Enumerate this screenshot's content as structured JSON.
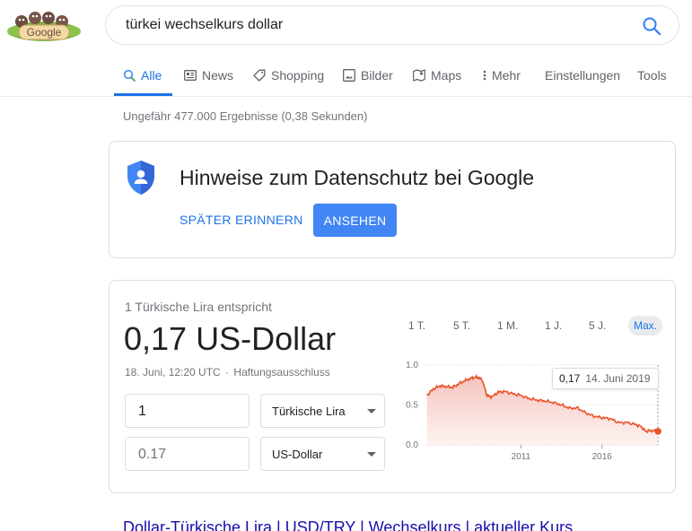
{
  "search": {
    "query": "türkei wechselkurs dollar"
  },
  "tabs": [
    {
      "label": "Alle"
    },
    {
      "label": "News"
    },
    {
      "label": "Shopping"
    },
    {
      "label": "Bilder"
    },
    {
      "label": "Maps"
    },
    {
      "label": "Mehr"
    },
    {
      "label": "Einstellungen"
    },
    {
      "label": "Tools"
    }
  ],
  "result_stats": "Ungefähr 477.000 Ergebnisse (0,38 Sekunden)",
  "privacy": {
    "title": "Hinweise zum Datenschutz bei Google",
    "later_label": "SPÄTER ERINNERN",
    "view_label": "ANSEHEN"
  },
  "currency": {
    "equivalent_label": "1 Türkische Lira entspricht",
    "rate": "0,17 US-Dollar",
    "timestamp": "18. Juni, 12:20 UTC",
    "disclaimer": "Haftungsausschluss",
    "amount_from": "1",
    "amount_to": "0.17",
    "currency_from": "Türkische Lira",
    "currency_to": "US-Dollar",
    "ranges": [
      "1 T.",
      "5 T.",
      "1 M.",
      "1 J.",
      "5 J.",
      "Max."
    ],
    "active_range": "Max.",
    "tooltip_value": "0,17",
    "tooltip_date": "14. Juni 2019"
  },
  "colors": {
    "accent": "#1a73e8",
    "line": "#e8542c",
    "fill": "#f6c9c4"
  },
  "chart_data": {
    "type": "area",
    "x": [
      2005.2,
      2005.6,
      2006.0,
      2006.4,
      2006.8,
      2007.2,
      2007.6,
      2008.0,
      2008.3,
      2008.6,
      2008.9,
      2009.2,
      2009.6,
      2010.0,
      2010.5,
      2011.0,
      2011.5,
      2012.0,
      2012.5,
      2013.0,
      2013.5,
      2014.0,
      2014.5,
      2015.0,
      2015.5,
      2016.0,
      2016.5,
      2017.0,
      2017.5,
      2018.0,
      2018.4,
      2018.7,
      2019.0,
      2019.45
    ],
    "y": [
      0.62,
      0.7,
      0.74,
      0.73,
      0.72,
      0.77,
      0.81,
      0.84,
      0.85,
      0.82,
      0.62,
      0.6,
      0.66,
      0.67,
      0.64,
      0.62,
      0.58,
      0.56,
      0.55,
      0.53,
      0.5,
      0.46,
      0.46,
      0.4,
      0.36,
      0.34,
      0.33,
      0.28,
      0.28,
      0.26,
      0.23,
      0.17,
      0.18,
      0.17
    ],
    "ylim": [
      0,
      1.0
    ],
    "xlim": [
      2005.0,
      2019.5
    ],
    "yticks": [
      "1.0",
      "0.5",
      "0.0"
    ],
    "ytick_values": [
      1.0,
      0.5,
      0.0
    ],
    "xticks": [
      "2011",
      "2016"
    ],
    "xtick_values": [
      2011,
      2016
    ]
  }
}
